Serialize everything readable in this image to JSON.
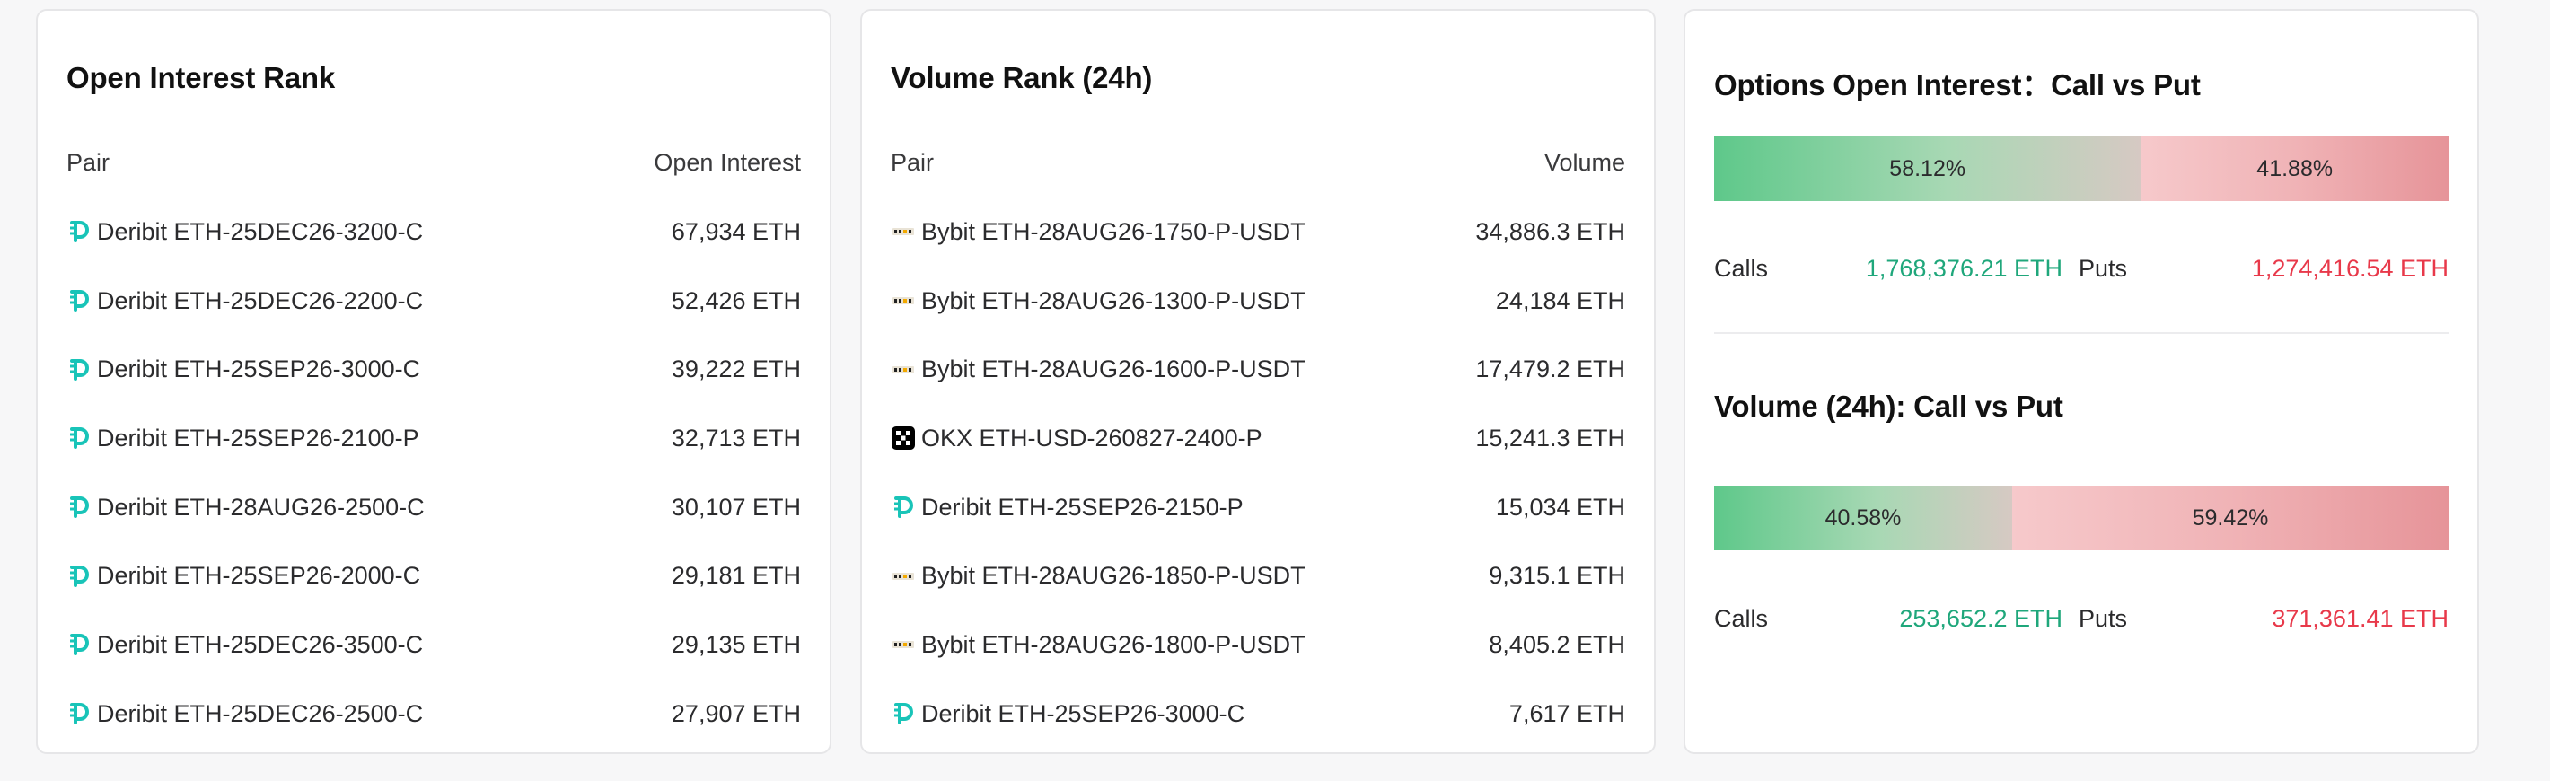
{
  "open_interest_rank": {
    "title": "Open Interest Rank",
    "col_pair": "Pair",
    "col_value": "Open Interest",
    "rows": [
      {
        "exchange": "Deribit",
        "pair": "Deribit ETH-25DEC26-3200-C",
        "value": "67,934 ETH"
      },
      {
        "exchange": "Deribit",
        "pair": "Deribit ETH-25DEC26-2200-C",
        "value": "52,426 ETH"
      },
      {
        "exchange": "Deribit",
        "pair": "Deribit ETH-25SEP26-3000-C",
        "value": "39,222 ETH"
      },
      {
        "exchange": "Deribit",
        "pair": "Deribit ETH-25SEP26-2100-P",
        "value": "32,713 ETH"
      },
      {
        "exchange": "Deribit",
        "pair": "Deribit ETH-28AUG26-2500-C",
        "value": "30,107 ETH"
      },
      {
        "exchange": "Deribit",
        "pair": "Deribit ETH-25SEP26-2000-C",
        "value": "29,181 ETH"
      },
      {
        "exchange": "Deribit",
        "pair": "Deribit ETH-25DEC26-3500-C",
        "value": "29,135 ETH"
      },
      {
        "exchange": "Deribit",
        "pair": "Deribit ETH-25DEC26-2500-C",
        "value": "27,907 ETH"
      }
    ]
  },
  "volume_rank": {
    "title": "Volume Rank (24h)",
    "col_pair": "Pair",
    "col_value": "Volume",
    "rows": [
      {
        "exchange": "Bybit",
        "pair": "Bybit ETH-28AUG26-1750-P-USDT",
        "value": "34,886.3 ETH"
      },
      {
        "exchange": "Bybit",
        "pair": "Bybit ETH-28AUG26-1300-P-USDT",
        "value": "24,184 ETH"
      },
      {
        "exchange": "Bybit",
        "pair": "Bybit ETH-28AUG26-1600-P-USDT",
        "value": "17,479.2 ETH"
      },
      {
        "exchange": "OKX",
        "pair": "OKX ETH-USD-260827-2400-P",
        "value": "15,241.3 ETH"
      },
      {
        "exchange": "Deribit",
        "pair": "Deribit ETH-25SEP26-2150-P",
        "value": "15,034 ETH"
      },
      {
        "exchange": "Bybit",
        "pair": "Bybit ETH-28AUG26-1850-P-USDT",
        "value": "9,315.1 ETH"
      },
      {
        "exchange": "Bybit",
        "pair": "Bybit ETH-28AUG26-1800-P-USDT",
        "value": "8,405.2 ETH"
      },
      {
        "exchange": "Deribit",
        "pair": "Deribit ETH-25SEP26-3000-C",
        "value": "7,617 ETH"
      }
    ]
  },
  "options_oi": {
    "title": "Options Open Interest：Call vs Put",
    "call_pct": 58.12,
    "put_pct": 41.88,
    "call_label": "58.12%",
    "put_label": "41.88%",
    "calls_key": "Calls",
    "calls_value": "1,768,376.21 ETH",
    "puts_key": "Puts",
    "puts_value": "1,274,416.54 ETH"
  },
  "volume_cp": {
    "title": "Volume (24h): Call vs Put",
    "call_pct": 40.58,
    "put_pct": 59.42,
    "call_label": "40.58%",
    "put_label": "59.42%",
    "calls_key": "Calls",
    "calls_value": "253,652.2 ETH",
    "puts_key": "Puts",
    "puts_value": "371,361.41 ETH"
  },
  "colors": {
    "calls": "#1fa77b",
    "puts": "#e8394a",
    "deribit": "#19c4b8"
  },
  "icons": {
    "Deribit": "deribit-logo-icon",
    "Bybit": "bybit-logo-icon",
    "OKX": "okx-logo-icon"
  }
}
